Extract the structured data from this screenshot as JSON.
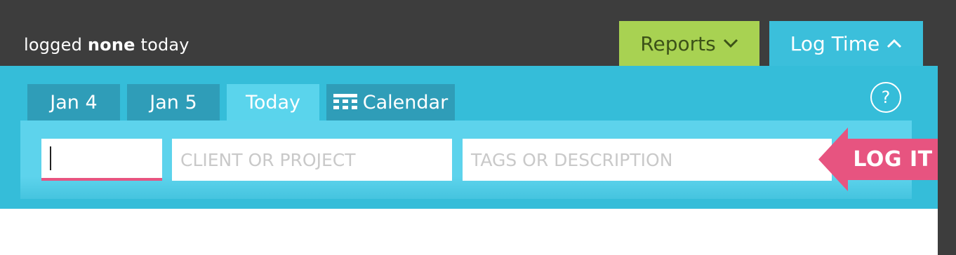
{
  "status": {
    "prefix": "logged",
    "value": "none",
    "suffix": "today"
  },
  "header": {
    "reports_label": "Reports",
    "logtime_label": "Log Time"
  },
  "tabs": [
    {
      "label": "Jan 4"
    },
    {
      "label": "Jan 5"
    },
    {
      "label": "Today",
      "active": true
    },
    {
      "label": "Calendar",
      "icon": "calendar-grid-icon"
    }
  ],
  "help": {
    "label": "?"
  },
  "form": {
    "time_value": "",
    "project_placeholder": "CLIENT OR PROJECT",
    "description_placeholder": "TAGS OR DESCRIPTION",
    "submit_label": "LOG IT"
  },
  "colors": {
    "accent_pink": "#e75480",
    "panel_blue": "#35bdd9",
    "reports_green": "#a8d252",
    "dark_background": "#3d3d3d"
  }
}
